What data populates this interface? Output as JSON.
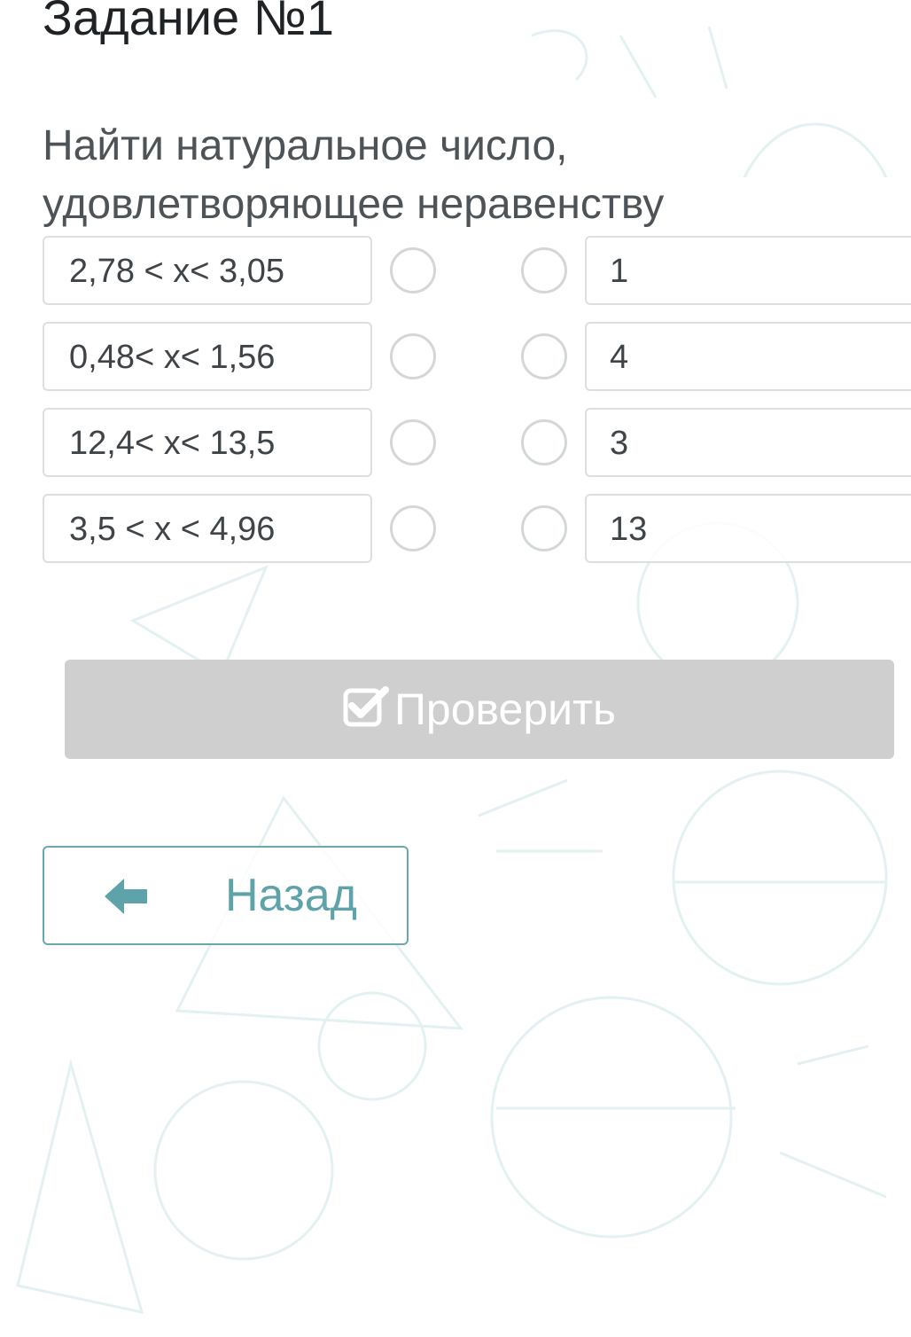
{
  "task": {
    "title": "Задание №1",
    "question": "Найти натуральное число, удовлетворяющее неравенству"
  },
  "pairs": {
    "left": [
      "2,78 < x< 3,05",
      "0,48< x< 1,56",
      "12,4< x< 13,5",
      "3,5 < x < 4,96"
    ],
    "right": [
      "1",
      "4",
      "3",
      "13"
    ]
  },
  "buttons": {
    "check_label": "Проверить",
    "back_label": "Назад"
  },
  "colors": {
    "check_button_bg": "#cfcfcf",
    "back_button_accent": "#5fa3aa",
    "border": "#dcdfe2"
  },
  "icons": {
    "check": "check-square-icon",
    "back": "arrow-left-icon"
  }
}
